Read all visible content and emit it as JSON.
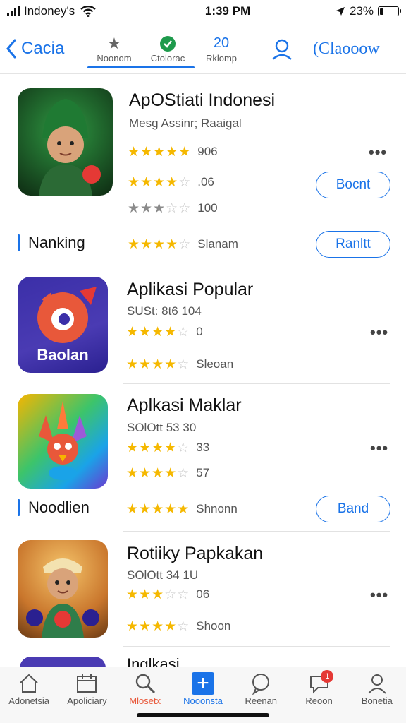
{
  "status_bar": {
    "carrier": "Indoney's",
    "time": "1:39 PM",
    "battery": "23%",
    "battery_level": 0.23
  },
  "topnav": {
    "back_label": "Cacia",
    "tabs": [
      {
        "label": "Noonom",
        "icon": "star-icon"
      },
      {
        "label": "Ctolorac",
        "icon": "leaf-badge-icon"
      },
      {
        "label": "Rklomp",
        "value": "20",
        "icon": "number-icon"
      }
    ],
    "profile_icon": "person-icon",
    "search_label": "(Claooow"
  },
  "apps": [
    {
      "title": "ApOStiati Indonesi",
      "subtitle": "Mesg Assinr; Raaigal",
      "icon_colors": [
        "#0e2a12",
        "#2f9a43"
      ],
      "ratings": [
        {
          "stars": 5,
          "style": "gold",
          "text": "906"
        },
        {
          "stars": 4,
          "style": "gold",
          "text": ".06"
        },
        {
          "stars": 3,
          "style": "grey",
          "text": "100"
        }
      ],
      "button_label": "Bocnt"
    },
    {
      "section_label": "Nanking",
      "ratings": [
        {
          "stars": 4,
          "style": "gold",
          "text": "Slanam"
        }
      ],
      "button_label": "Ranltt"
    },
    {
      "title": "Aplikasi Popular",
      "subtitle": "SUSt: 8t6 104",
      "icon_text": "Baolan",
      "icon_colors": [
        "#3b2fa8",
        "#e8583a"
      ],
      "ratings": [
        {
          "stars": 3.5,
          "style": "gold",
          "text": "0"
        },
        {
          "stars": 4,
          "style": "gold",
          "text": "Sleoan"
        }
      ]
    },
    {
      "title": "Aplkasi Maklar",
      "subtitle": "SOlOtt 53 30",
      "icon_colors": [
        "#f7b500",
        "#1aa3e8"
      ],
      "ratings": [
        {
          "stars": 4,
          "style": "gold",
          "text": "33"
        },
        {
          "stars": 4,
          "style": "gold",
          "text": "57"
        }
      ],
      "section_label": "Noodlien",
      "section_rating": {
        "stars": 5,
        "style": "gold",
        "text": "Shnonn"
      },
      "button_label": "Band"
    },
    {
      "title": "Rotiiky Papkakan",
      "subtitle": "SOlOtt 34 1U",
      "icon_colors": [
        "#8a4a1c",
        "#e8a33a"
      ],
      "ratings": [
        {
          "stars": 3,
          "style": "gold",
          "text": "06"
        },
        {
          "stars": 4,
          "style": "gold",
          "text": "Shoon"
        }
      ]
    }
  ],
  "peek_title": "Inglkasi",
  "more_label": "•••",
  "tabbar": [
    {
      "label": "Adonetsia",
      "icon": "home-icon",
      "color": "default"
    },
    {
      "label": "Apoliciary",
      "icon": "calendar-icon",
      "color": "default"
    },
    {
      "label": "Mlosetx",
      "icon": "search-icon",
      "color": "red"
    },
    {
      "label": "Nooonsta",
      "icon": "plus-square-icon",
      "color": "blue"
    },
    {
      "label": "Reenan",
      "icon": "chat-bubble-icon",
      "color": "default"
    },
    {
      "label": "Reoon",
      "icon": "message-icon",
      "color": "default",
      "badge": "1"
    },
    {
      "label": "Bonetia",
      "icon": "person-icon",
      "color": "default"
    }
  ]
}
